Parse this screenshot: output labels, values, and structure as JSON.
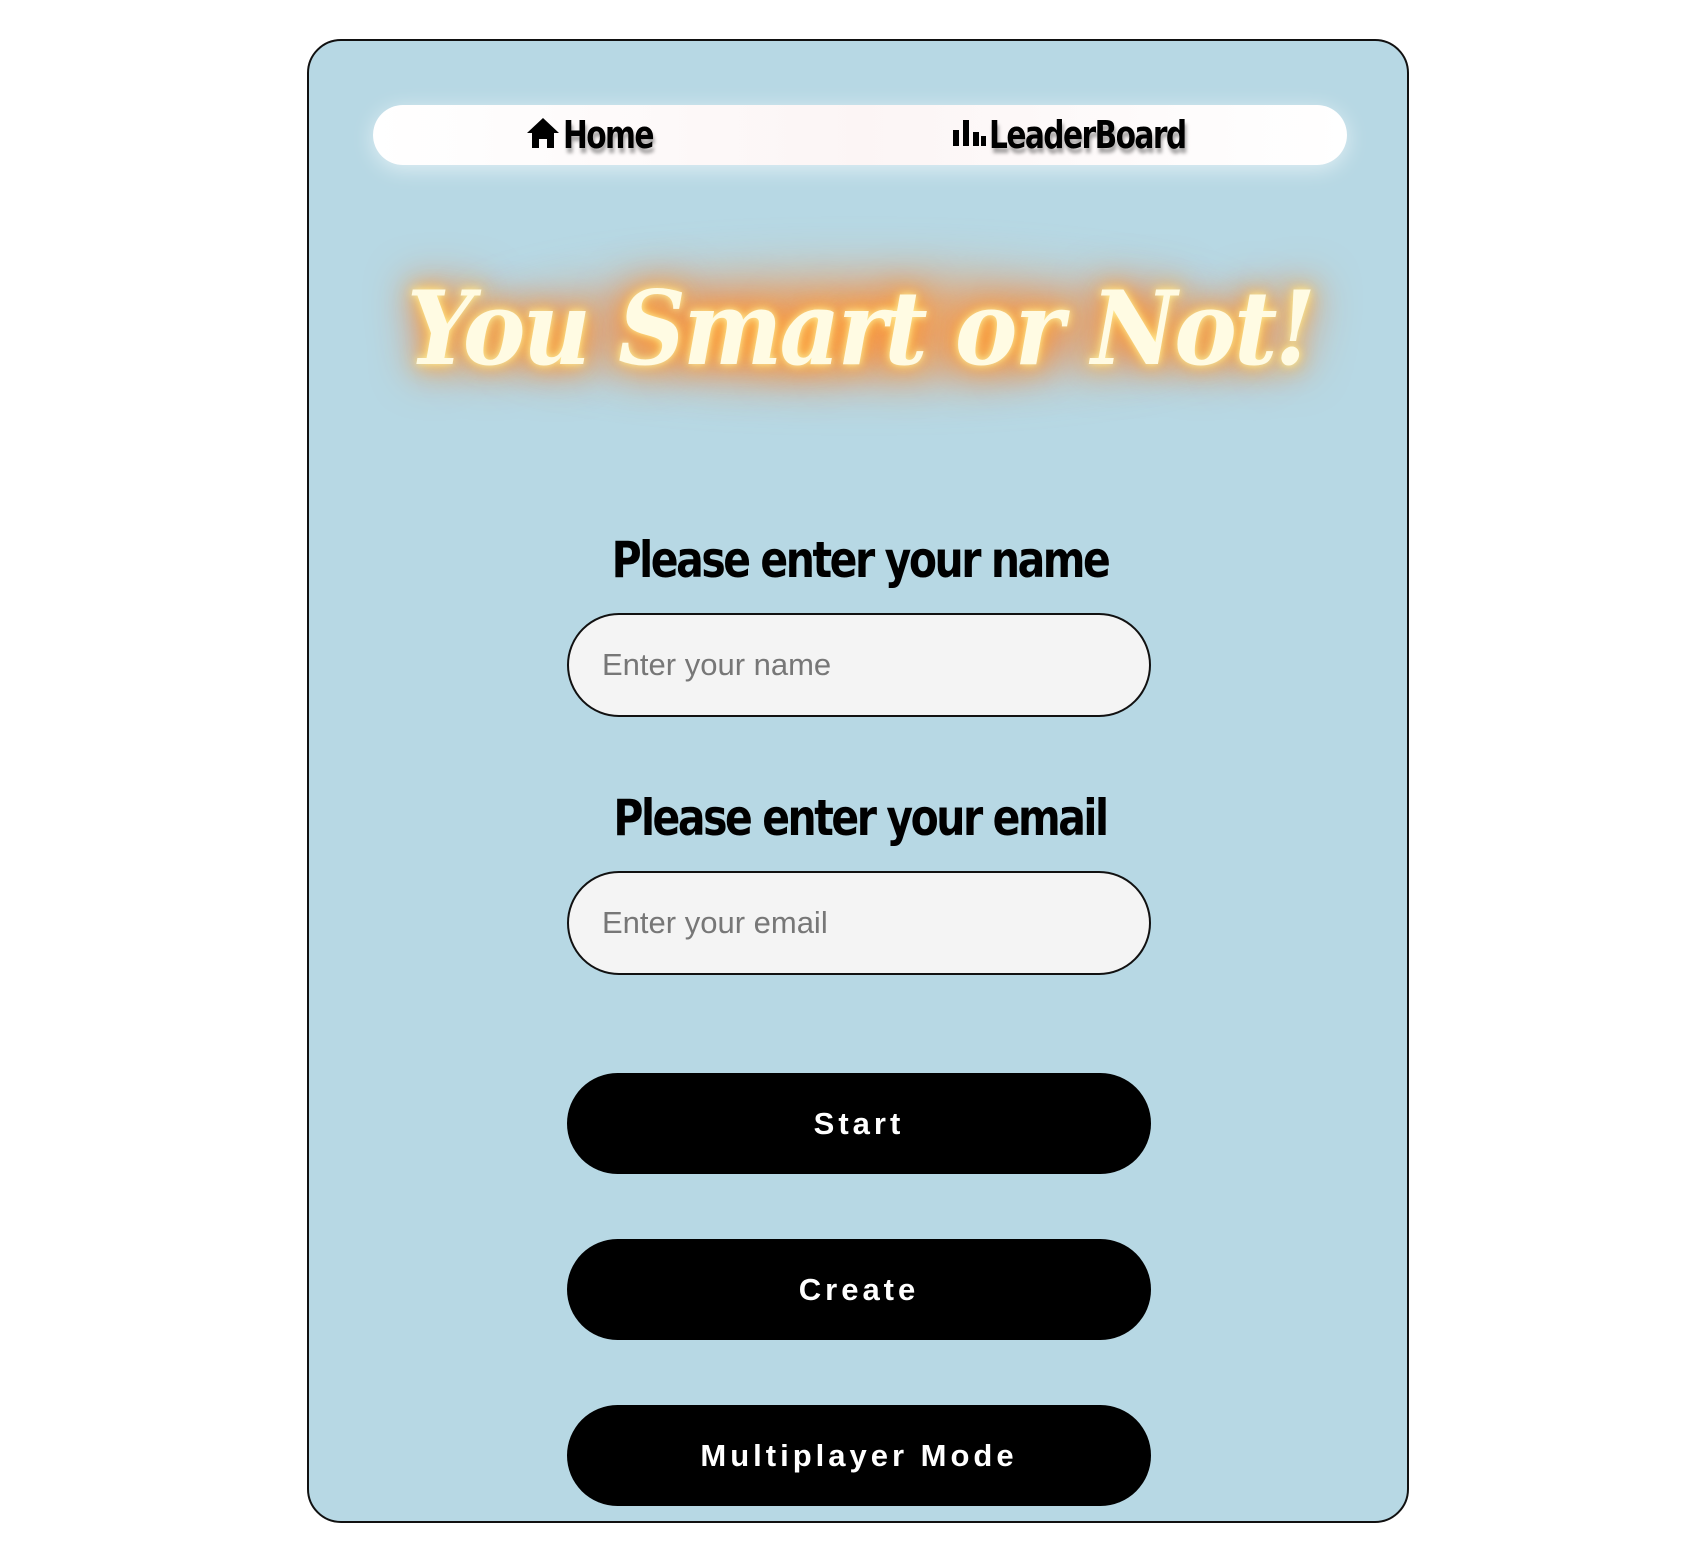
{
  "nav": {
    "home_label": "Home",
    "home_icon": "home-icon",
    "leaderboard_label": "LeaderBoard",
    "leaderboard_icon": "bar-chart-icon"
  },
  "title": "You Smart or Not!",
  "form": {
    "name_label": "Please enter your name",
    "name_placeholder": "Enter your name",
    "name_value": "",
    "email_label": "Please enter your email",
    "email_placeholder": "Enter your email",
    "email_value": ""
  },
  "buttons": {
    "start": "Start",
    "create": "Create",
    "multiplayer": "Multiplayer Mode"
  },
  "colors": {
    "card_background": "#b7d8e4",
    "button_background": "#000000",
    "button_text": "#ffffff",
    "title_text": "#fffbe3",
    "title_glow": "#ff8a2a",
    "input_background": "#f4f4f4"
  }
}
